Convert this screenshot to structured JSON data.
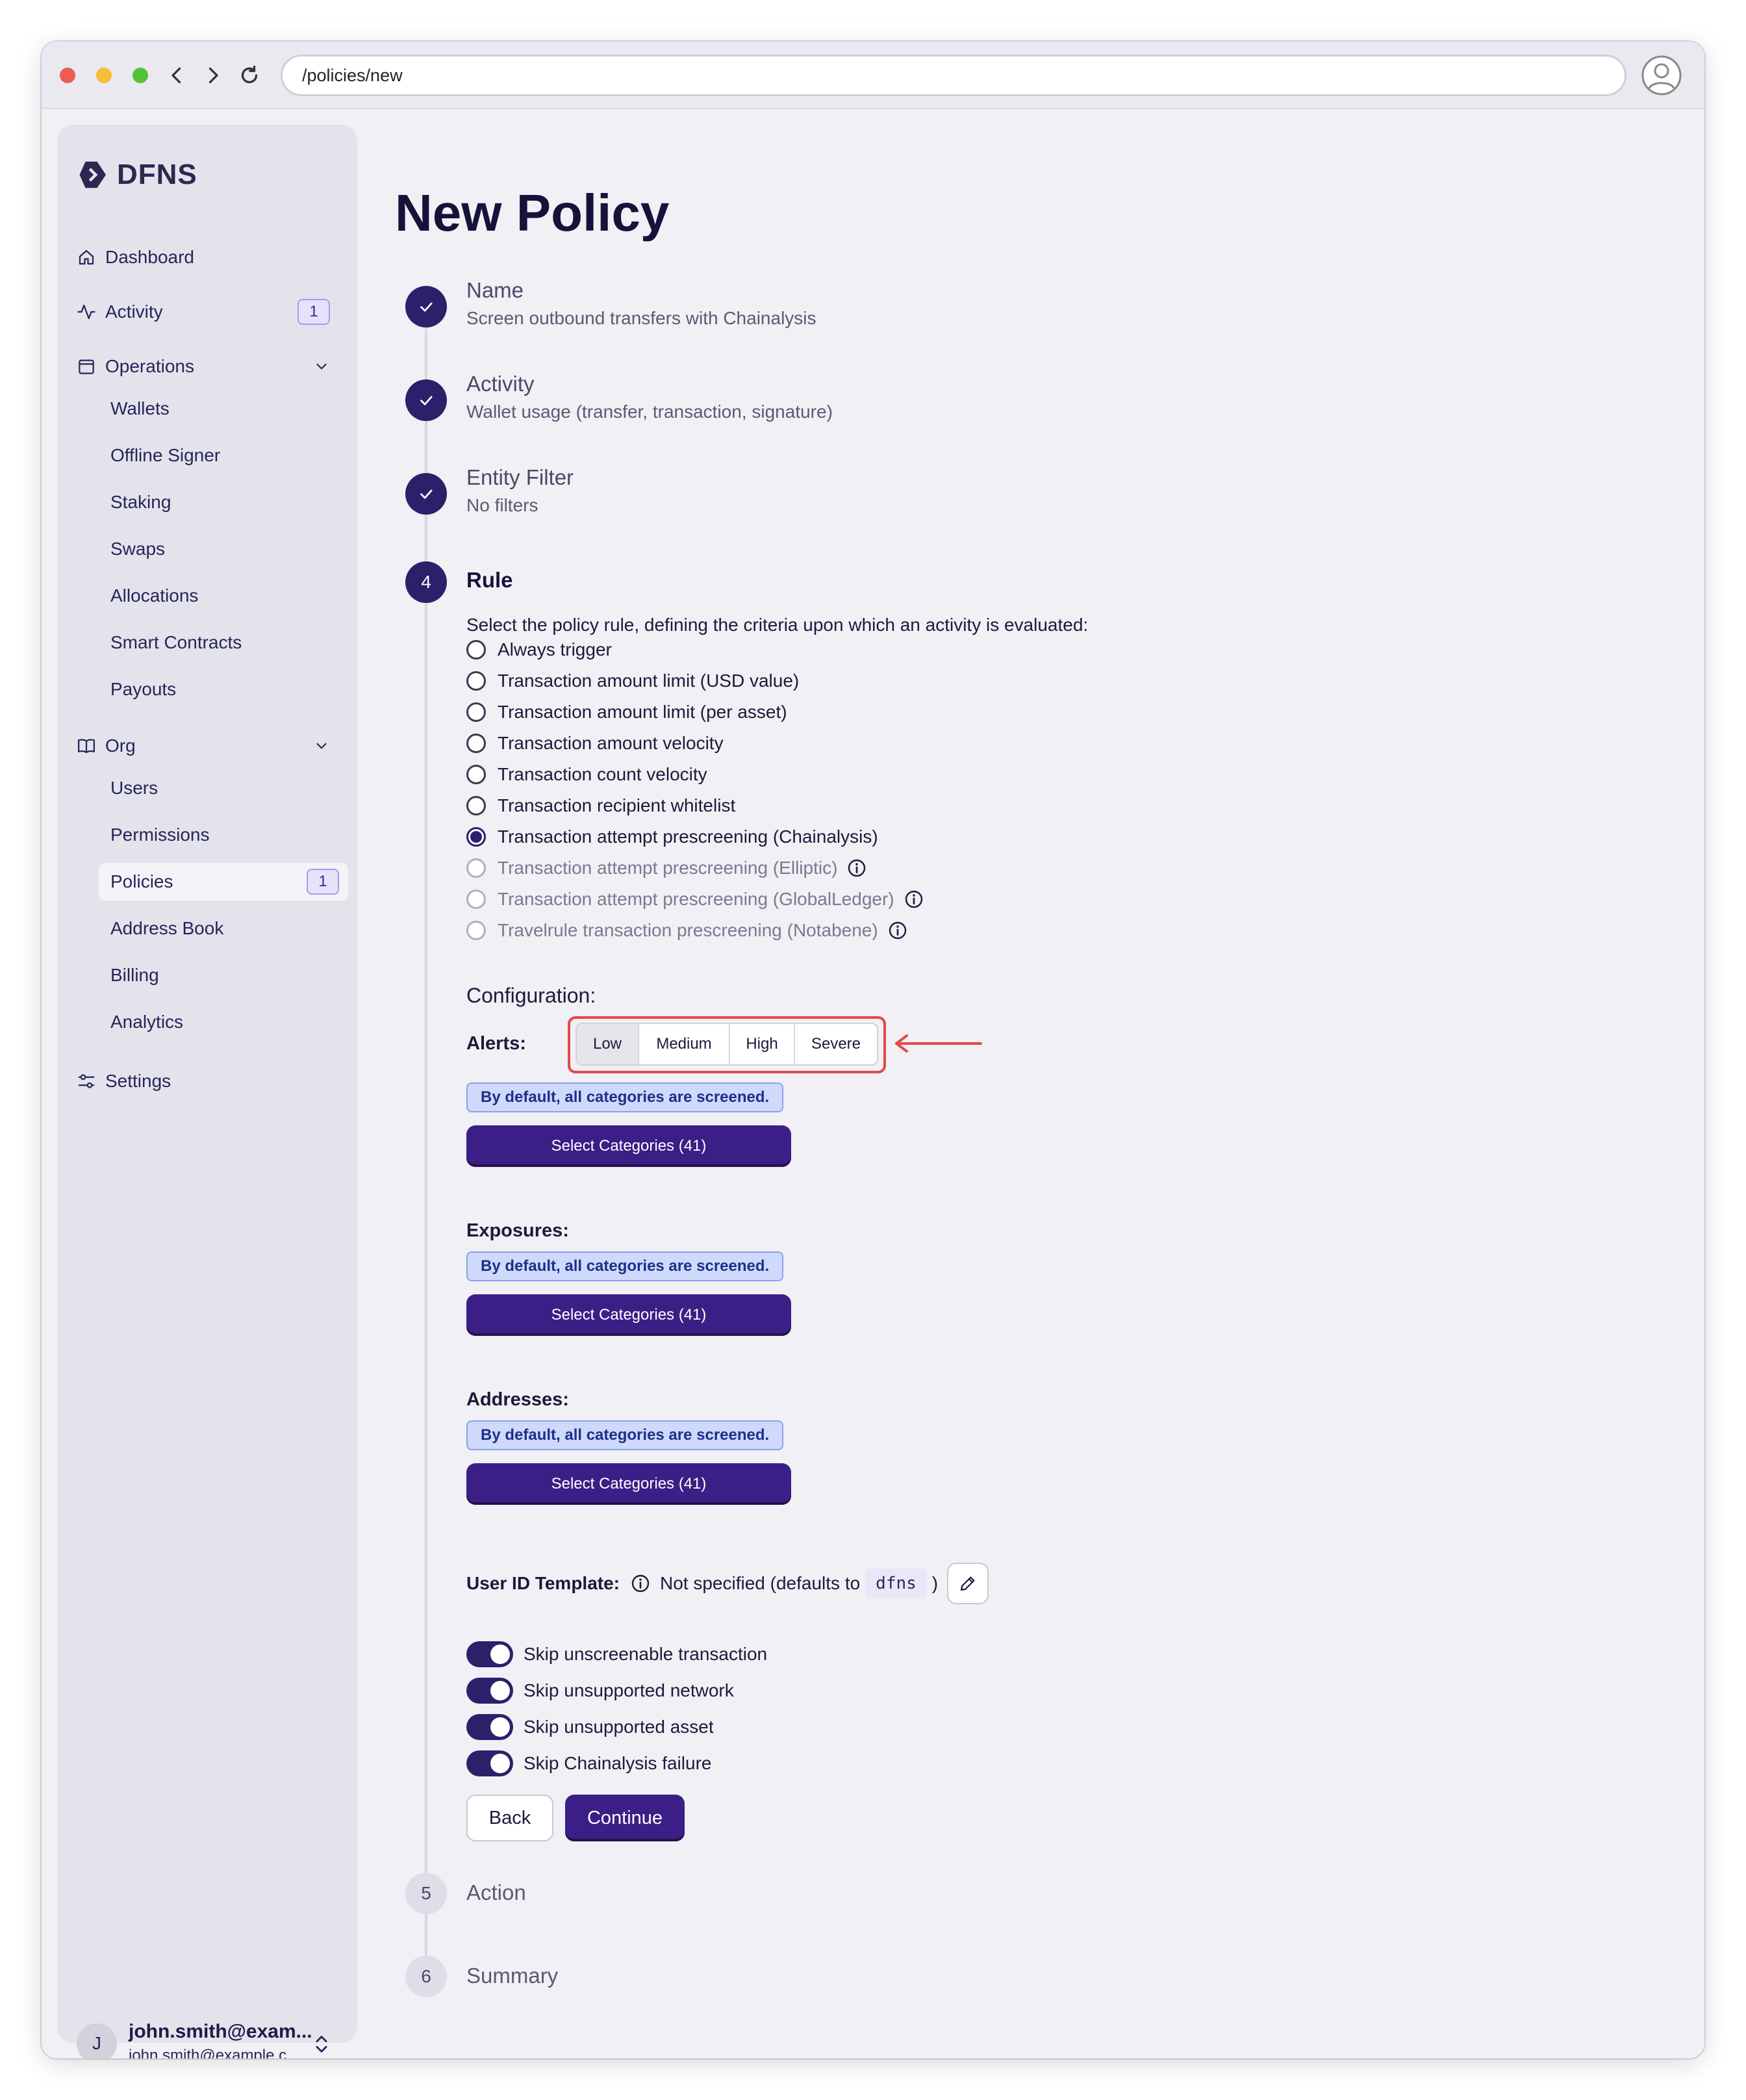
{
  "browser": {
    "url": "/policies/new"
  },
  "sidebar": {
    "logo_text": "DFNS",
    "dashboard": "Dashboard",
    "activity": {
      "label": "Activity",
      "badge": "1"
    },
    "operations": "Operations",
    "operations_items": [
      "Wallets",
      "Offline Signer",
      "Staking",
      "Swaps",
      "Allocations",
      "Smart Contracts",
      "Payouts"
    ],
    "org": "Org",
    "org_items": {
      "users": "Users",
      "permissions": "Permissions",
      "policies": {
        "label": "Policies",
        "badge": "1"
      },
      "address_book": "Address Book",
      "billing": "Billing",
      "analytics": "Analytics"
    },
    "settings": "Settings",
    "user": {
      "initial": "J",
      "name": "john.smith@exam...",
      "email": "john.smith@example.c..."
    }
  },
  "page": {
    "title": "New Policy",
    "steps": [
      {
        "number": "1",
        "title": "Name",
        "subtitle": "Screen outbound transfers with Chainalysis",
        "status": "done"
      },
      {
        "number": "2",
        "title": "Activity",
        "subtitle": "Wallet usage (transfer, transaction, signature)",
        "status": "done"
      },
      {
        "number": "3",
        "title": "Entity Filter",
        "subtitle": "No filters",
        "status": "done"
      },
      {
        "number": "4",
        "title": "Rule",
        "subtitle": "",
        "status": "current"
      },
      {
        "number": "5",
        "title": "Action",
        "subtitle": "",
        "status": "pending"
      },
      {
        "number": "6",
        "title": "Summary",
        "subtitle": "",
        "status": "pending"
      }
    ],
    "rule": {
      "prompt": "Select the policy rule, defining the criteria upon which an activity is evaluated:",
      "options": [
        {
          "label": "Always trigger",
          "selected": false,
          "disabled": false
        },
        {
          "label": "Transaction amount limit (USD value)",
          "selected": false,
          "disabled": false
        },
        {
          "label": "Transaction amount limit (per asset)",
          "selected": false,
          "disabled": false
        },
        {
          "label": "Transaction amount velocity",
          "selected": false,
          "disabled": false
        },
        {
          "label": "Transaction count velocity",
          "selected": false,
          "disabled": false
        },
        {
          "label": "Transaction recipient whitelist",
          "selected": false,
          "disabled": false
        },
        {
          "label": "Transaction attempt prescreening (Chainalysis)",
          "selected": true,
          "disabled": false
        },
        {
          "label": "Transaction attempt prescreening (Elliptic)",
          "selected": false,
          "disabled": true
        },
        {
          "label": "Transaction attempt prescreening (GlobalLedger)",
          "selected": false,
          "disabled": true
        },
        {
          "label": "Travelrule transaction prescreening (Notabene)",
          "selected": false,
          "disabled": true
        }
      ],
      "configuration_label": "Configuration:",
      "alerts": {
        "label": "Alerts:",
        "levels": [
          "Low",
          "Medium",
          "High",
          "Severe"
        ],
        "selected": "Low",
        "note": "By default, all categories are screened.",
        "button": "Select Categories (41)"
      },
      "exposures": {
        "label": "Exposures:",
        "note": "By default, all categories are screened.",
        "button": "Select Categories (41)"
      },
      "addresses": {
        "label": "Addresses:",
        "note": "By default, all categories are screened.",
        "button": "Select Categories (41)"
      },
      "user_id_template": {
        "label": "User ID Template:",
        "text": "Not specified (defaults to",
        "code": "dfns",
        "close": ")"
      },
      "toggles": [
        {
          "label": "Skip unscreenable transaction",
          "on": true
        },
        {
          "label": "Skip unsupported network",
          "on": true
        },
        {
          "label": "Skip unsupported asset",
          "on": true
        },
        {
          "label": "Skip Chainalysis failure",
          "on": true
        }
      ],
      "back": "Back",
      "continue": "Continue"
    }
  },
  "colors": {
    "primary": "#2e1f6b",
    "button": "#3b1f86",
    "annotation": "#e04a4a",
    "note_bg": "#cfd9fb"
  }
}
